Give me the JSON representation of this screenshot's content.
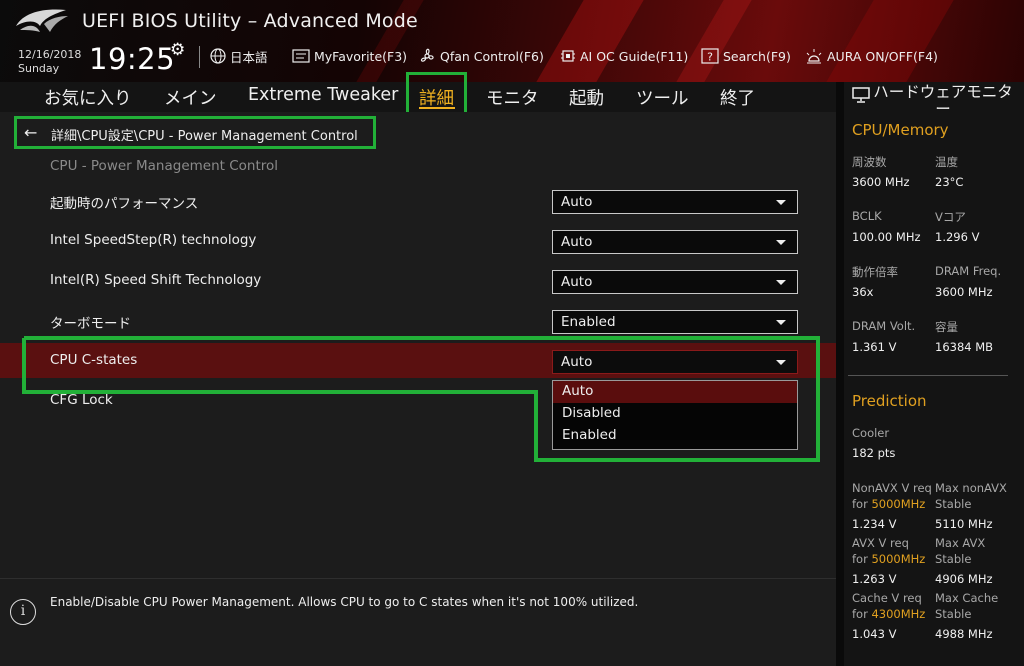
{
  "header": {
    "title": "UEFI BIOS Utility – Advanced Mode",
    "date": "12/16/2018",
    "day": "Sunday",
    "time": "19:25",
    "tools": {
      "language": "日本語",
      "my_favorite": "MyFavorite(F3)",
      "qfan": "Qfan Control(F6)",
      "ai_oc": "AI OC Guide(F11)",
      "search": "Search(F9)",
      "aura": "AURA ON/OFF(F4)"
    }
  },
  "nav": {
    "tabs": [
      {
        "label": "お気に入り"
      },
      {
        "label": "メイン"
      },
      {
        "label": "Extreme Tweaker"
      },
      {
        "label": "詳細"
      },
      {
        "label": "モニタ"
      },
      {
        "label": "起動"
      },
      {
        "label": "ツール"
      },
      {
        "label": "終了"
      }
    ],
    "active_index": 3
  },
  "main": {
    "breadcrumb": "詳細\\CPU設定\\CPU - Power Management Control",
    "section_title": "CPU - Power Management Control",
    "settings": [
      {
        "label": "起動時のパフォーマンス",
        "value": "Auto"
      },
      {
        "label": "Intel SpeedStep(R) technology",
        "value": "Auto"
      },
      {
        "label": "Intel(R) Speed Shift Technology",
        "value": "Auto"
      },
      {
        "label": "ターボモード",
        "value": "Enabled"
      },
      {
        "label": "CPU C-states",
        "value": "Auto"
      },
      {
        "label": "CFG Lock",
        "value": ""
      }
    ],
    "dropdown_options": [
      "Auto",
      "Disabled",
      "Enabled"
    ],
    "dropdown_selected": "Auto"
  },
  "help": {
    "text": "Enable/Disable CPU Power Management. Allows CPU to go to C states when it's not 100% utilized."
  },
  "hw_monitor": {
    "title": "ハードウェアモニター",
    "cpu_memory": {
      "heading": "CPU/Memory",
      "frequency_label": "周波数",
      "frequency_value": "3600 MHz",
      "temperature_label": "温度",
      "temperature_value": "23°C",
      "bclk_label": "BCLK",
      "bclk_value": "100.00 MHz",
      "vcore_label": "Vコア",
      "vcore_value": "1.296 V",
      "ratio_label": "動作倍率",
      "ratio_value": "36x",
      "dram_freq_label": "DRAM Freq.",
      "dram_freq_value": "3600 MHz",
      "dram_volt_label": "DRAM Volt.",
      "dram_volt_value": "1.361 V",
      "capacity_label": "容量",
      "capacity_value": "16384 MB"
    },
    "prediction": {
      "heading": "Prediction",
      "cooler_label": "Cooler",
      "cooler_value": "182 pts",
      "nonavx_req_label": "NonAVX V req",
      "nonavx_for": "for ",
      "nonavx_freq": "5000MHz",
      "nonavx_req_value": "1.234 V",
      "max_nonavx_label": "Max nonAVX",
      "max_nonavx_sub": "Stable",
      "max_nonavx_value": "5110 MHz",
      "avx_req_label": "AVX V req",
      "avx_for": "for ",
      "avx_freq": "5000MHz",
      "avx_req_value": "1.263 V",
      "max_avx_label": "Max AVX",
      "max_avx_sub": "Stable",
      "max_avx_value": "4906 MHz",
      "cache_req_label": "Cache V req",
      "cache_for": "for ",
      "cache_freq": "4300MHz",
      "cache_req_value": "1.043 V",
      "max_cache_label": "Max Cache",
      "max_cache_sub": "Stable",
      "max_cache_value": "4988 MHz"
    }
  },
  "colors": {
    "accent": "#f0b020",
    "highlight_row": "#5a1010",
    "annotation_green": "#22b038",
    "section_heading": "#e0a020"
  }
}
